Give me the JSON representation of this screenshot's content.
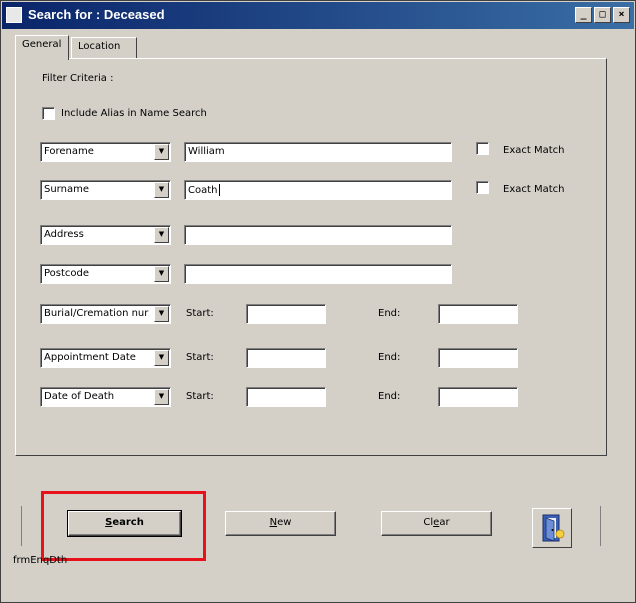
{
  "window": {
    "title": "Search for : Deceased"
  },
  "title_buttons": {
    "minimize": "_",
    "maximize": "□",
    "close": "×"
  },
  "tabs": [
    {
      "label": "General",
      "active": true
    },
    {
      "label": "Location",
      "active": false
    }
  ],
  "filter": {
    "heading": "Filter Criteria :",
    "include_alias_label": "Include Alias in Name Search",
    "include_alias_checked": false
  },
  "rows": [
    {
      "field": "Forename",
      "value": "William",
      "exact_label": "Exact Match",
      "exact_checked": false
    },
    {
      "field": "Surname",
      "value": "Coath",
      "exact_label": "Exact Match",
      "exact_checked": false
    },
    {
      "field": "Address",
      "value": ""
    },
    {
      "field": "Postcode",
      "value": ""
    }
  ],
  "range_rows": [
    {
      "field": "Burial/Cremation nur",
      "start_label": "Start:",
      "end_label": "End:",
      "start": "",
      "end": ""
    },
    {
      "field": "Appointment Date",
      "start_label": "Start:",
      "end_label": "End:",
      "start": "",
      "end": ""
    },
    {
      "field": "Date of Death",
      "start_label": "Start:",
      "end_label": "End:",
      "start": "",
      "end": ""
    }
  ],
  "buttons": {
    "search": {
      "accel": "S",
      "rest": "earch"
    },
    "new": {
      "accel": "N",
      "rest": "ew"
    },
    "clear": {
      "pre": "Cl",
      "accel": "e",
      "rest": "ar"
    },
    "exit_icon": "door-exit-icon"
  },
  "status": {
    "text": "frmEnqDth"
  },
  "colors": {
    "title_start": "#0a246a",
    "title_end": "#3a6ea5",
    "highlight": "#e8111b",
    "face": "#d4d0c8"
  }
}
